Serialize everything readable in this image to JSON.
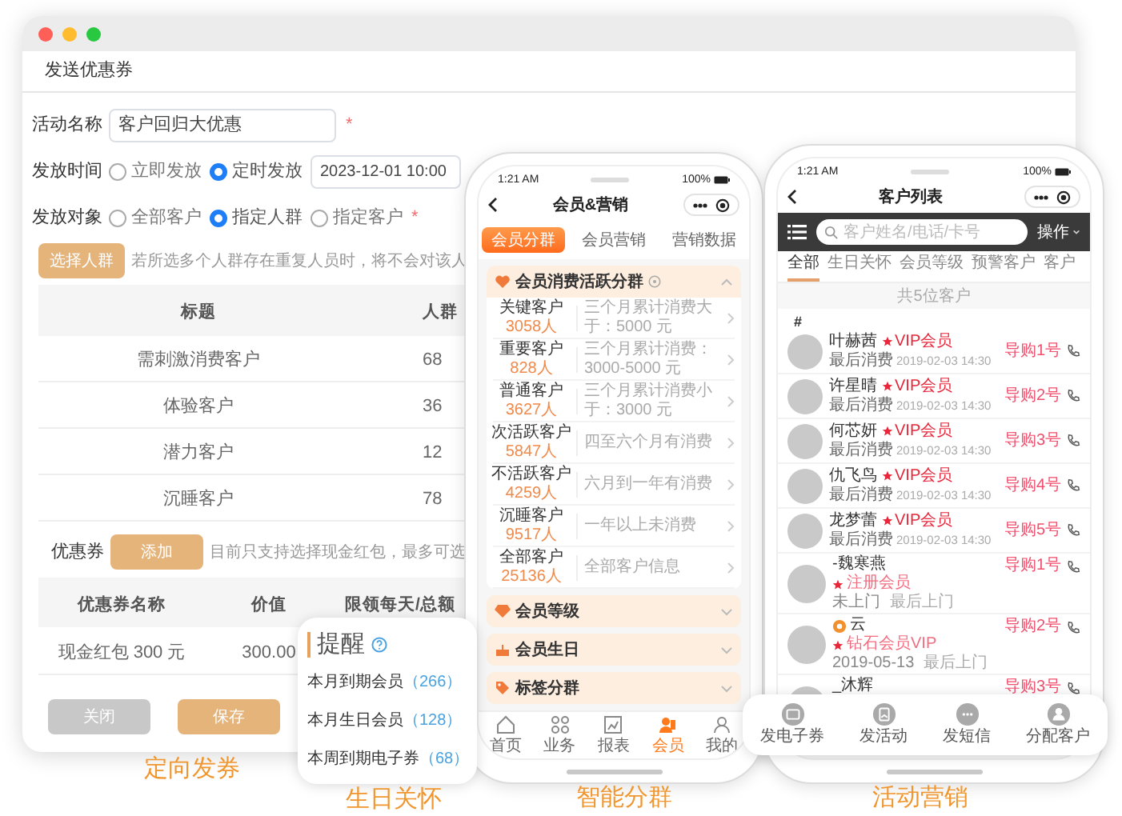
{
  "window": {
    "title": "发送优惠券"
  },
  "form": {
    "activity_name": {
      "label": "活动名称",
      "value": "客户回归大优惠",
      "required": "*"
    },
    "send_time": {
      "label": "发放时间",
      "options": [
        {
          "label": "立即发放",
          "selected": false
        },
        {
          "label": "定时发放",
          "selected": true
        }
      ],
      "value": "2023-12-01 10:00"
    },
    "audience": {
      "label": "发放对象",
      "options": [
        {
          "label": "全部客户",
          "selected": false
        },
        {
          "label": "指定人群",
          "selected": true
        },
        {
          "label": "指定客户",
          "selected": false
        }
      ],
      "required": "*"
    },
    "group_button": "选择人群",
    "group_hint": "若所选多个人群存在重复人员时，将不会对该人",
    "group_table": {
      "columns": [
        "标题",
        "人群"
      ],
      "rows": [
        [
          "需刺激消费客户",
          "68"
        ],
        [
          "体验客户",
          "36"
        ],
        [
          "潜力客户",
          "12"
        ],
        [
          "沉睡客户",
          "78"
        ]
      ]
    },
    "coupon_label": "优惠券",
    "coupon_button": "添加",
    "coupon_hint": "目前只支持选择现金红包，最多可选",
    "coupon_table": {
      "columns": [
        "优惠券名称",
        "价值",
        "限领每天/总额"
      ],
      "rows": [
        [
          "现金红包 300 元",
          "300.00"
        ]
      ]
    },
    "buttons": [
      {
        "label": "关闭",
        "kind": "secondary"
      },
      {
        "label": "保存",
        "kind": "primary"
      }
    ]
  },
  "reminder": {
    "title": "提醒",
    "items": [
      {
        "label": "本月到期会员",
        "count": "（266）"
      },
      {
        "label": "本月生日会员",
        "count": "（128）"
      },
      {
        "label": "本周到期电子券",
        "count": "（68）"
      }
    ]
  },
  "segments_phone": {
    "time": "1:21 AM",
    "battery": "100%",
    "title": "会员&营销",
    "tabs": [
      {
        "label": "会员分群",
        "selected": true
      },
      {
        "label": "会员营销",
        "selected": false
      },
      {
        "label": "营销数据",
        "selected": false
      }
    ],
    "sections": [
      {
        "title": "会员消费活跃分群",
        "help": true,
        "expanded": true,
        "rows": [
          {
            "name": "关键客户",
            "count": "3058人",
            "description": "三个月累计消费大于：5000 元"
          },
          {
            "name": "重要客户",
            "count": "828人",
            "description": "三个月累计消费：3000-5000 元"
          },
          {
            "name": "普通客户",
            "count": "3627人",
            "description": "三个月累计消费小于：3000 元"
          },
          {
            "name": "次活跃客户",
            "count": "5847人",
            "description": "四至六个月有消费"
          },
          {
            "name": "不活跃客户",
            "count": "4259人",
            "description": "六月到一年有消费"
          },
          {
            "name": "沉睡客户",
            "count": "9517人",
            "description": "一年以上未消费"
          },
          {
            "name": "全部客户",
            "count": "25136人",
            "description": "全部客户信息"
          }
        ]
      },
      {
        "title": "会员等级",
        "help": false,
        "expanded": false
      },
      {
        "title": "会员生日",
        "help": false,
        "expanded": false
      },
      {
        "title": "标签分群",
        "help": false,
        "expanded": false
      }
    ],
    "nav": [
      {
        "label": "首页",
        "selected": false
      },
      {
        "label": "业务",
        "selected": false
      },
      {
        "label": "报表",
        "selected": false
      },
      {
        "label": "会员",
        "selected": true
      },
      {
        "label": "我的",
        "selected": false
      }
    ]
  },
  "customers_phone": {
    "time": "1:21 AM",
    "battery": "100%",
    "title": "客户列表",
    "search": {
      "placeholder": "客户姓名/电话/卡号"
    },
    "action": "操作",
    "tabs": [
      {
        "label": "全部",
        "selected": true
      },
      {
        "label": "生日关怀",
        "selected": false
      },
      {
        "label": "会员等级",
        "selected": false
      },
      {
        "label": "预警客户",
        "selected": false
      },
      {
        "label": "客户",
        "selected": false
      }
    ],
    "count": "共5位客户",
    "index": "#",
    "customers": [
      {
        "kind": "member",
        "name": "叶赫茜",
        "tag": "VIP会员",
        "label": "最后消费",
        "date": "2019-02-03 14:30",
        "guide": "导购1号"
      },
      {
        "kind": "member",
        "name": "许星晴",
        "tag": "VIP会员",
        "label": "最后消费",
        "date": "2019-02-03 14:30",
        "guide": "导购2号"
      },
      {
        "kind": "member",
        "name": "何芯妍",
        "tag": "VIP会员",
        "label": "最后消费",
        "date": "2019-02-03 14:30",
        "guide": "导购3号"
      },
      {
        "kind": "member",
        "name": "仇飞鸟",
        "tag": "VIP会员",
        "label": "最后消费",
        "date": "2019-02-03 14:30",
        "guide": "导购4号"
      },
      {
        "kind": "member",
        "name": "龙梦蕾",
        "tag": "VIP会员",
        "label": "最后消费",
        "date": "2019-02-03 14:30",
        "guide": "导购5号"
      },
      {
        "kind": "visit",
        "name": "-魏寒燕",
        "badge": false,
        "tag": "注册会员",
        "status": "未上门",
        "label": "最后上门",
        "guide": "导购1号"
      },
      {
        "kind": "visit",
        "name": "云",
        "badge": true,
        "tag": "钻石会员VIP",
        "status": "2019-05-13",
        "label": "最后上门",
        "guide": "导购2号"
      },
      {
        "kind": "visit",
        "name": "_沐辉",
        "badge": false,
        "guide": "导购3号"
      }
    ]
  },
  "action_bar": [
    {
      "label": "发电子券"
    },
    {
      "label": "发活动"
    },
    {
      "label": "发短信"
    },
    {
      "label": "分配客户"
    }
  ],
  "captions": [
    "定向发券",
    "生日关怀",
    "智能分群",
    "活动营销"
  ]
}
